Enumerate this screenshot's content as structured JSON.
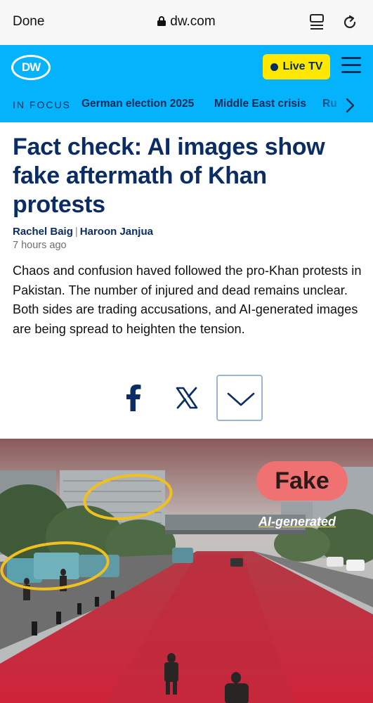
{
  "browser": {
    "done_label": "Done",
    "url": "dw.com"
  },
  "header": {
    "logo_text": "DW",
    "live_label": "Live TV",
    "accent_color": "#05b2fc",
    "live_color": "#ffe700"
  },
  "focus_nav": {
    "label": "IN FOCUS",
    "items": [
      "German election 2025",
      "Middle East crisis",
      "Ru"
    ]
  },
  "article": {
    "headline": "Fact check: AI images show fake aftermath of Khan protests",
    "author_1": "Rachel Baig",
    "separator": "|",
    "author_2": "Haroon Janjua",
    "time": "7 hours ago",
    "teaser": "Chaos and confusion haved followed the pro-Khan protests in Pakistan. The number of injured and dead remains unclear. Both sides are trading accusations, and AI-generated images are being spread to heighten the tension."
  },
  "share": {
    "icons": [
      "facebook-icon",
      "x-icon",
      "chevron-down-icon"
    ]
  },
  "image": {
    "badge": "Fake",
    "label": "AI-generated"
  }
}
